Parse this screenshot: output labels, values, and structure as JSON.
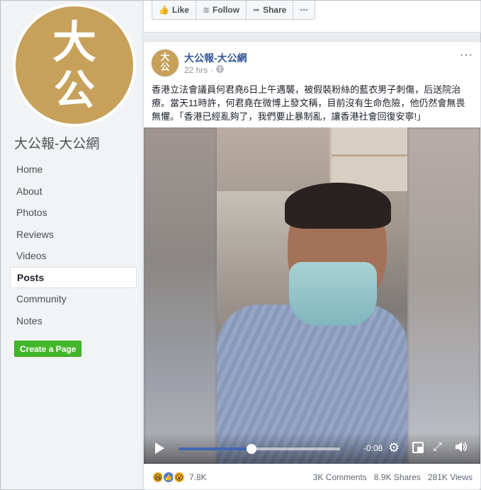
{
  "page": {
    "avatar_glyph_top": "大",
    "avatar_glyph_bottom": "公",
    "name": "大公報-大公網"
  },
  "nav": {
    "items": [
      "Home",
      "About",
      "Photos",
      "Reviews",
      "Videos",
      "Posts",
      "Community",
      "Notes"
    ],
    "active": "Posts",
    "create_page_label": "Create a Page"
  },
  "top_actions": {
    "like": "Like",
    "follow": "Follow",
    "share": "Share",
    "more": "···"
  },
  "post": {
    "author": "大公報-大公網",
    "avatar_glyph_top": "大",
    "avatar_glyph_bottom": "公",
    "time": "22 hrs",
    "separator": "·",
    "privacy_icon": "globe-icon",
    "more": "···",
    "text": "香港立法會議員何君堯6日上午遇襲，被假裝粉絲的藍衣男子刺傷，后送院治療。當天11時許，何君堯在微博上發文稱，目前沒有生命危險，他仍然會無畏無懼。「香港已經亂夠了，我們要止暴制亂，讓香港社會回復安寧!」"
  },
  "video": {
    "time_remaining": "-0:08",
    "progress": 0.45,
    "settings_icon": "gear-icon",
    "fullscreen_icon": "expand-icon",
    "volume_icon": "speaker-icon",
    "pip_icon": "picture-in-picture-icon"
  },
  "footer": {
    "reaction_count": "7.8K",
    "comments": "3K Comments",
    "shares": "8.9K Shares",
    "views": "281K Views"
  }
}
